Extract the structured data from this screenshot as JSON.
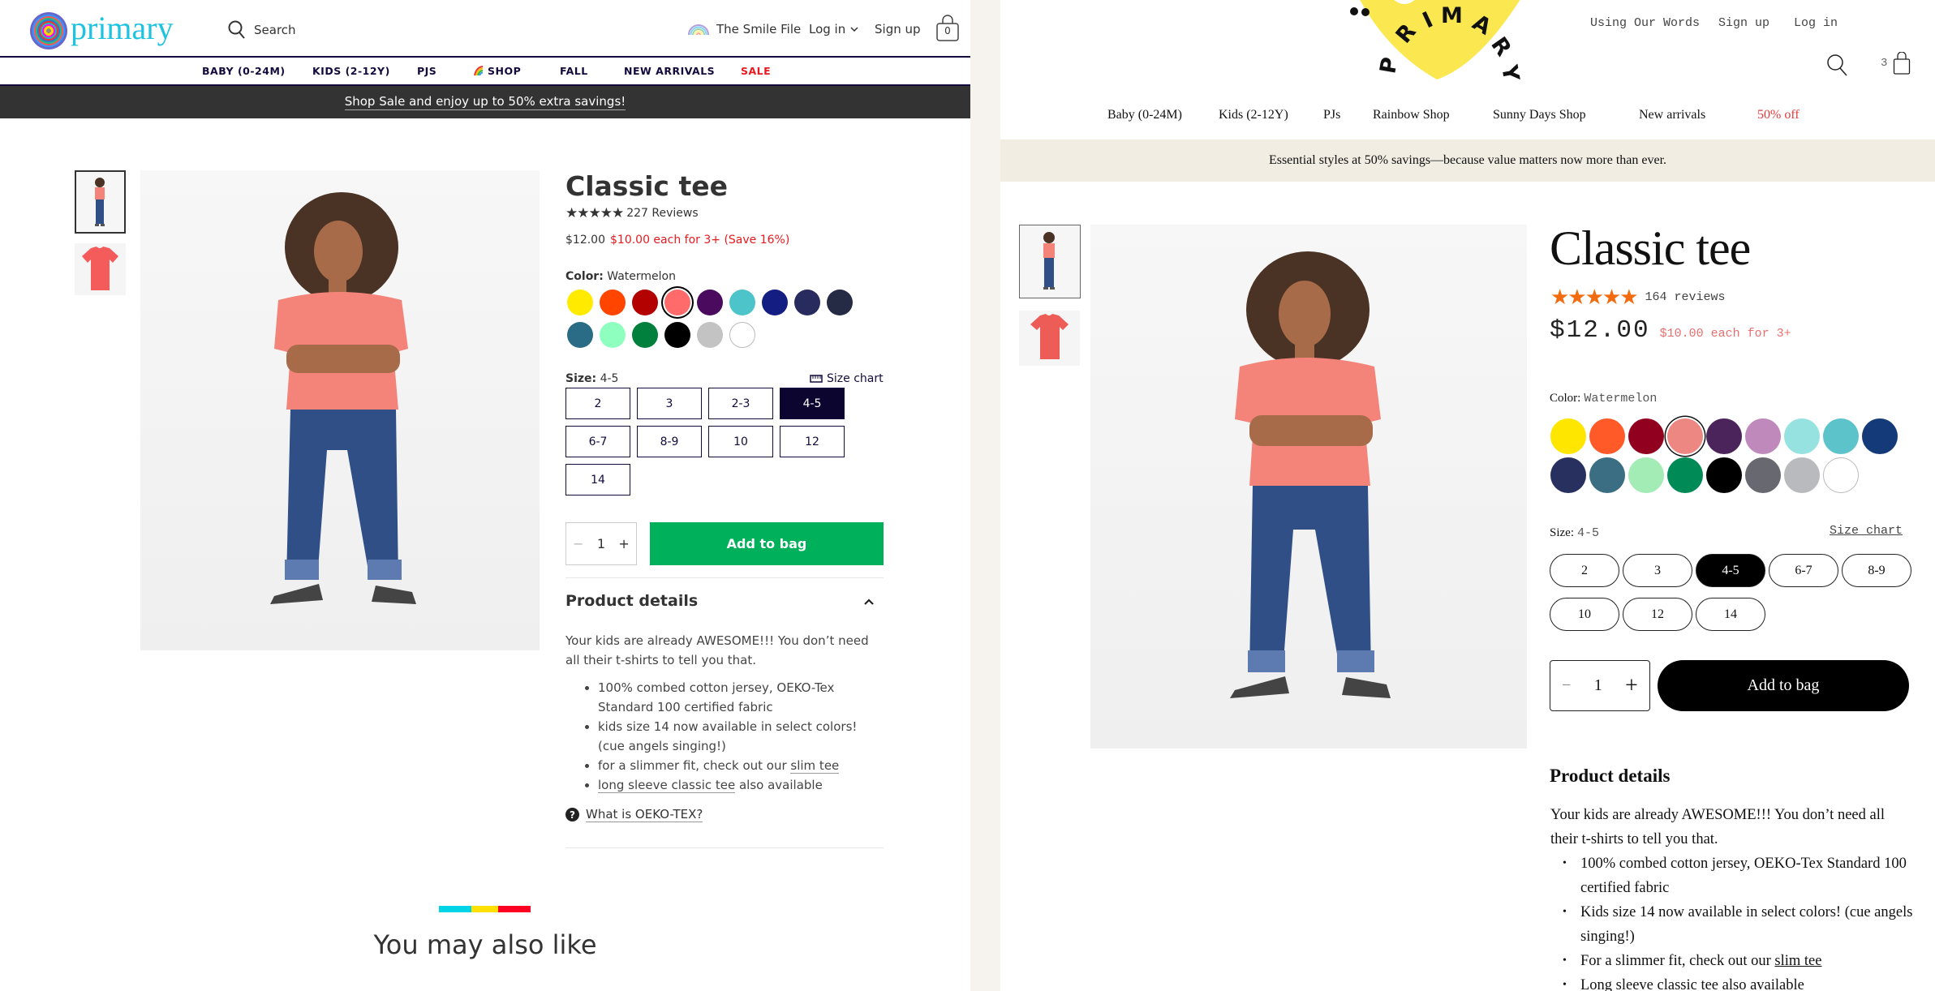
{
  "left": {
    "logo_text": "primary",
    "search_label": "Search",
    "top_links": {
      "smile_file": "The Smile File",
      "log_in": "Log in",
      "sign_up": "Sign up",
      "bag_count": "0"
    },
    "nav": [
      {
        "label": "BABY (0-24M)"
      },
      {
        "label": "KIDS (2-12Y)"
      },
      {
        "label": "PJS"
      },
      {
        "label": "SHOP"
      },
      {
        "label": "FALL"
      },
      {
        "label": "NEW ARRIVALS"
      },
      {
        "label": "SALE"
      }
    ],
    "banner": "Shop Sale and enjoy up to 50% extra savings!",
    "product": {
      "title": "Classic tee",
      "rating": 5,
      "reviews": "227 Reviews",
      "price": "$12.00",
      "sale_price": "$10.00 each for 3+ (Save 16%)",
      "color_label": "Color:",
      "color_value": "Watermelon",
      "swatches": [
        {
          "name": "yellow",
          "hex": "#ffea00"
        },
        {
          "name": "orange",
          "hex": "#ff4500"
        },
        {
          "name": "red",
          "hex": "#b30000"
        },
        {
          "name": "watermelon",
          "hex": "#ff6b6b",
          "selected": true
        },
        {
          "name": "purple",
          "hex": "#4a0a5e"
        },
        {
          "name": "turquoise",
          "hex": "#4cc4c9"
        },
        {
          "name": "royal-blue",
          "hex": "#141e82"
        },
        {
          "name": "navy",
          "hex": "#272b5e"
        },
        {
          "name": "midnight",
          "hex": "#252a45"
        },
        {
          "name": "teal-blue",
          "hex": "#2a6c86"
        },
        {
          "name": "mint",
          "hex": "#8fffc0"
        },
        {
          "name": "green",
          "hex": "#00803c"
        },
        {
          "name": "black",
          "hex": "#000000"
        },
        {
          "name": "grey",
          "hex": "#c3c3c3"
        },
        {
          "name": "white",
          "hex": "#ffffff"
        }
      ],
      "size_label": "Size:",
      "size_value": "4-5",
      "size_chart": "Size chart",
      "sizes": [
        {
          "label": "2"
        },
        {
          "label": "3"
        },
        {
          "label": "2-3"
        },
        {
          "label": "4-5",
          "selected": true
        },
        {
          "label": "6-7"
        },
        {
          "label": "8-9"
        },
        {
          "label": "10"
        },
        {
          "label": "12"
        },
        {
          "label": "14"
        }
      ],
      "quantity": "1",
      "qty_minus": "−",
      "qty_plus": "+",
      "add_to_bag": "Add to bag",
      "details_title": "Product details",
      "details_intro": "Your kids are already AWESOME!!! You don’t need all their t-shirts to tell you that.",
      "bullets": {
        "b1": "100% combed cotton jersey, OEKO-Tex Standard 100 certified fabric",
        "b2": "kids size 14 now available in select colors! (cue angels singing!)",
        "b3_text": "for a slimmer fit, check out our ",
        "b3_link": "slim tee",
        "b4_link": "long sleeve classic tee",
        "b4_text": " also available"
      },
      "oeko_link": "What is OEKO-TEX?"
    },
    "you_may_also_like": "You may also like",
    "accent_colors": {
      "cyan": "#00d4e6",
      "yellow": "#ffe000",
      "red": "#ff0022",
      "green_button": "#00b05a",
      "sale_red": "#e8191f"
    }
  },
  "right": {
    "logo_text": "PRIMARY",
    "top_links": {
      "using_our_words": "Using Our Words",
      "sign_up": "Sign up",
      "log_in": "Log in",
      "bag_count": "3"
    },
    "nav": [
      {
        "label": "Baby (0-24M)"
      },
      {
        "label": "Kids (2-12Y)"
      },
      {
        "label": "PJs"
      },
      {
        "label": "Rainbow Shop"
      },
      {
        "label": "Sunny Days Shop"
      },
      {
        "label": "New arrivals"
      },
      {
        "label": "50% off"
      }
    ],
    "banner": "Essential styles at 50% savings—because value matters now more than ever.",
    "product": {
      "title": "Classic tee",
      "rating": 5,
      "reviews": "164 reviews",
      "price": "$12.00",
      "sale_price": "$10.00 each for 3+",
      "color_label": "Color:",
      "color_value": "Watermelon",
      "swatches": [
        {
          "name": "yellow",
          "hex": "#ffe600"
        },
        {
          "name": "orange",
          "hex": "#ff5a28"
        },
        {
          "name": "red",
          "hex": "#920020"
        },
        {
          "name": "watermelon",
          "hex": "#ec8782",
          "selected": true
        },
        {
          "name": "purple",
          "hex": "#4c245c"
        },
        {
          "name": "lilac",
          "hex": "#c089bb"
        },
        {
          "name": "aqua",
          "hex": "#96e2e0"
        },
        {
          "name": "turquoise",
          "hex": "#5cc3cb"
        },
        {
          "name": "royal-blue",
          "hex": "#153a7a"
        },
        {
          "name": "navy",
          "hex": "#27305e"
        },
        {
          "name": "teal-blue",
          "hex": "#3b6e82"
        },
        {
          "name": "mint",
          "hex": "#a3ecb6"
        },
        {
          "name": "green",
          "hex": "#008a55"
        },
        {
          "name": "black",
          "hex": "#000000"
        },
        {
          "name": "charcoal",
          "hex": "#686870"
        },
        {
          "name": "grey",
          "hex": "#b9babd"
        },
        {
          "name": "white",
          "hex": "#ffffff"
        }
      ],
      "size_label": "Size:",
      "size_value": "4-5",
      "size_chart": "Size chart",
      "sizes": [
        {
          "label": "2"
        },
        {
          "label": "3"
        },
        {
          "label": "4-5",
          "selected": true
        },
        {
          "label": "6-7"
        },
        {
          "label": "8-9"
        },
        {
          "label": "10"
        },
        {
          "label": "12"
        },
        {
          "label": "14"
        }
      ],
      "quantity": "1",
      "qty_minus": "−",
      "qty_plus": "+",
      "add_to_bag": "Add to bag",
      "details_title": "Product details",
      "details_intro": "Your kids are already AWESOME!!! You don’t need all their t-shirts to tell you that.",
      "bullets": {
        "b1": "100% combed cotton jersey, OEKO-Tex Standard 100 certified fabric",
        "b2": "Kids size 14 now available in select colors! (cue angels singing!)",
        "b3_text": "For a slimmer fit, check out our ",
        "b3_link": "slim tee",
        "b4": "Long sleeve classic tee also available"
      }
    },
    "accent_colors": {
      "logo_yellow": "#fbe74f",
      "star_orange": "#f26b0f",
      "sale_red": "#e23b3b",
      "banner_bg": "#f1ede3"
    }
  }
}
